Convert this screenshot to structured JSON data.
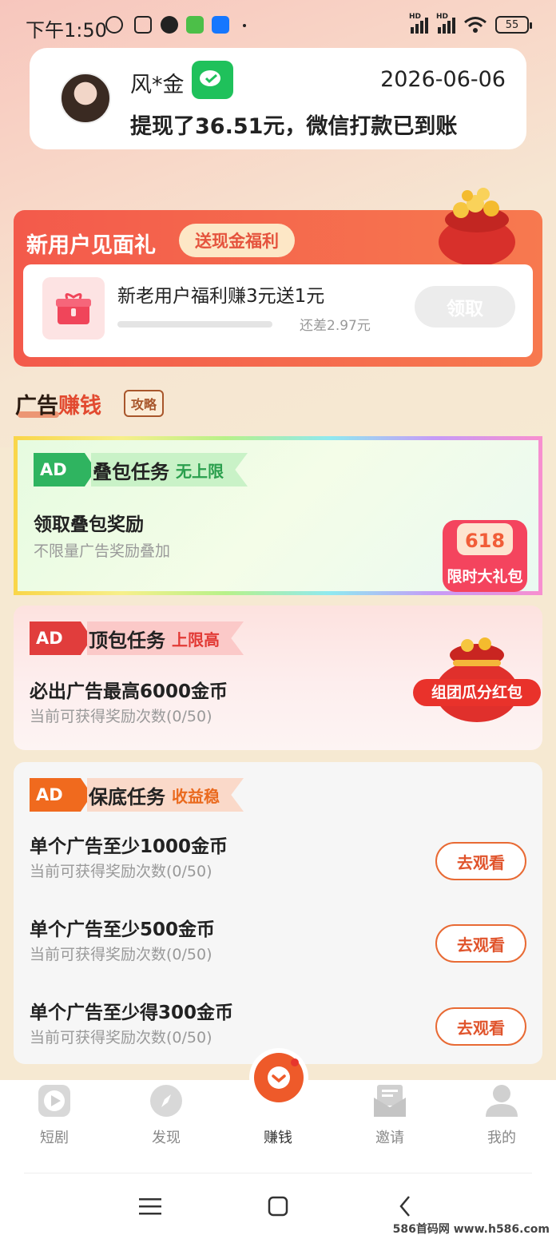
{
  "status_bar": {
    "time": "下午1:50",
    "battery": "55",
    "signal_label": "HD"
  },
  "withdraw_notice": {
    "user_name": "风*金",
    "date": "2026-06-06",
    "message": "提现了36.51元，微信打款已到账"
  },
  "new_user_gift": {
    "title": "新用户见面礼",
    "tag": "送现金福利",
    "description": "新老用户福利赚3元送1元",
    "remaining": "还差2.97元",
    "claim_label": "领取",
    "progress": 0.01
  },
  "ads_section": {
    "heading_part1": "广告",
    "heading_part2": "赚钱",
    "guide_label": "攻略"
  },
  "tasks": [
    {
      "badge": "AD",
      "name": "叠包任务",
      "tag": "无上限",
      "line1": "领取叠包奖励",
      "line2": "不限量广告奖励叠加",
      "promo_number": "618",
      "promo_text": "限时大礼包"
    },
    {
      "badge": "AD",
      "name": "顶包任务",
      "tag": "上限高",
      "line1": "必出广告最高6000金币",
      "line2": "当前可获得奖励次数(0/50)",
      "promo_text": "组团瓜分红包"
    },
    {
      "badge": "AD",
      "name": "保底任务",
      "tag": "收益稳",
      "rows": [
        {
          "line1": "单个广告至少1000金币",
          "line2": "当前可获得奖励次数(0/50)",
          "button": "去观看"
        },
        {
          "line1": "单个广告至少500金币",
          "line2": "当前可获得奖励次数(0/50)",
          "button": "去观看"
        },
        {
          "line1": "单个广告至少得300金币",
          "line2": "当前可获得奖励次数(0/50)",
          "button": "去观看"
        }
      ]
    }
  ],
  "bottom_nav": [
    {
      "label": "短剧",
      "icon": "play-icon"
    },
    {
      "label": "发现",
      "icon": "compass-icon"
    },
    {
      "label": "赚钱",
      "icon": "chevron-down-icon",
      "active": true
    },
    {
      "label": "邀请",
      "icon": "invite-icon"
    },
    {
      "label": "我的",
      "icon": "profile-icon"
    }
  ],
  "watermark": "586首码网 www.h586.com",
  "colors": {
    "accent_red": "#e24a30",
    "wechat_green": "#1fc15b",
    "ad_green": "#2fb460",
    "ad_red": "#e13d3c",
    "ad_orange": "#f06a1e"
  }
}
